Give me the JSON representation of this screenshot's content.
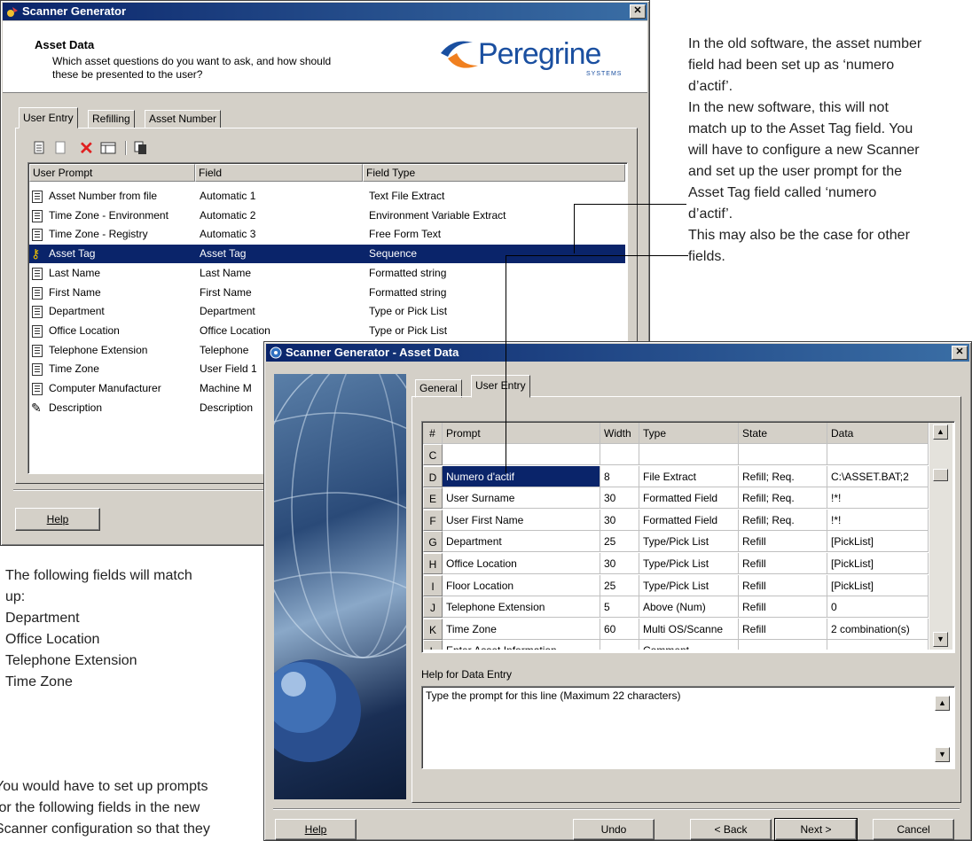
{
  "win1": {
    "title": "Scanner Generator",
    "header_title": "Asset Data",
    "header_desc": "Which asset questions do you want to ask, and how should these be presented to the user?",
    "logo_text": "Peregrine",
    "logo_sub": "SYSTEMS",
    "tabs": [
      "User Entry",
      "Refilling",
      "Asset Number"
    ],
    "columns": [
      "User Prompt",
      "Field",
      "Field Type"
    ],
    "rows": [
      {
        "prompt": "Asset Number from file",
        "field": "Automatic 1",
        "type": "Text File Extract",
        "icon": "document-icon"
      },
      {
        "prompt": "Time Zone - Environment",
        "field": "Automatic 2",
        "type": "Environment Variable Extract",
        "icon": "document-icon"
      },
      {
        "prompt": "Time Zone - Registry",
        "field": "Automatic 3",
        "type": "Free Form Text",
        "icon": "document-icon"
      },
      {
        "prompt": "Asset Tag",
        "field": "Asset Tag",
        "type": "Sequence",
        "icon": "key-icon"
      },
      {
        "prompt": "Last Name",
        "field": "Last Name",
        "type": "Formatted string",
        "icon": "document-icon"
      },
      {
        "prompt": "First Name",
        "field": "First Name",
        "type": "Formatted string",
        "icon": "document-icon"
      },
      {
        "prompt": "Department",
        "field": "Department",
        "type": "Type or Pick List",
        "icon": "document-icon"
      },
      {
        "prompt": "Office Location",
        "field": "Office Location",
        "type": "Type or Pick List",
        "icon": "document-icon"
      },
      {
        "prompt": "Telephone Extension",
        "field": "Telephone",
        "type": "",
        "icon": "document-icon"
      },
      {
        "prompt": "Time Zone",
        "field": "User Field 1",
        "type": "",
        "icon": "document-icon"
      },
      {
        "prompt": "Computer Manufacturer",
        "field": "Machine M",
        "type": "",
        "icon": "document-icon"
      },
      {
        "prompt": "Description",
        "field": "Description",
        "type": "",
        "icon": "pencil-icon"
      }
    ],
    "help_label": "Help"
  },
  "win2": {
    "title": "Scanner Generator - Asset Data",
    "tabs": [
      "General",
      "User Entry"
    ],
    "columns": [
      "#",
      "Prompt",
      "Width",
      "Type",
      "State",
      "Data"
    ],
    "rows": [
      {
        "key": "C",
        "prompt": "",
        "width": "",
        "type": "",
        "state": "",
        "data": ""
      },
      {
        "key": "D",
        "prompt": "Numero d'actif",
        "width": "8",
        "type": "File Extract",
        "state": "Refill; Req.",
        "data": "C:\\ASSET.BAT;2"
      },
      {
        "key": "E",
        "prompt": "User Surname",
        "width": "30",
        "type": "Formatted Field",
        "state": "Refill; Req.",
        "data": "!*!"
      },
      {
        "key": "F",
        "prompt": "User First Name",
        "width": "30",
        "type": "Formatted Field",
        "state": "Refill; Req.",
        "data": "!*!"
      },
      {
        "key": "G",
        "prompt": "Department",
        "width": "25",
        "type": "Type/Pick List",
        "state": "Refill",
        "data": "[PickList]"
      },
      {
        "key": "H",
        "prompt": "Office Location",
        "width": "30",
        "type": "Type/Pick List",
        "state": "Refill",
        "data": "[PickList]"
      },
      {
        "key": "I",
        "prompt": "Floor Location",
        "width": "25",
        "type": "Type/Pick List",
        "state": "Refill",
        "data": "[PickList]"
      },
      {
        "key": "J",
        "prompt": "Telephone Extension",
        "width": "5",
        "type": "Above (Num)",
        "state": "Refill",
        "data": "0"
      },
      {
        "key": "K",
        "prompt": "Time Zone",
        "width": "60",
        "type": "Multi OS/Scanne",
        "state": "Refill",
        "data": "2 combination(s)"
      },
      {
        "key": "L",
        "prompt": "Enter Asset Information",
        "width": "",
        "type": "Comment",
        "state": "",
        "data": ""
      }
    ],
    "help_title": "Help for Data Entry",
    "help_text": "Type the prompt for this line (Maximum 22 characters)",
    "buttons": {
      "help": "Help",
      "undo": "Undo",
      "back": "< Back",
      "next": "Next >",
      "cancel": "Cancel"
    }
  },
  "notes": {
    "right_lines": [
      "In the old software, the asset number",
      "field had been set up as ‘numero",
      "d’actif’.",
      "In the new software, this will not",
      "match up to the Asset Tag field. You",
      "will have to configure a new Scanner",
      "and set up the user prompt for the",
      "Asset Tag field called ‘numero",
      "d’actif’.",
      "This may also be the case for other",
      "fields."
    ],
    "left_lines": [
      "The following fields will match",
      "up:",
      "Department",
      "Office Location",
      "Telephone Extension",
      "Time Zone"
    ],
    "bottom_lines": [
      "You would have to set up prompts",
      "for the following fields in the new",
      "Scanner configuration so that they"
    ]
  }
}
